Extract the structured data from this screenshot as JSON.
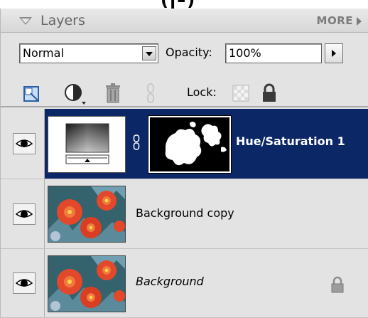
{
  "panel": {
    "title": "Layers",
    "more_label": "MORE",
    "top_glyphs": "(ן–)"
  },
  "controls": {
    "blend_mode": "Normal",
    "opacity_label": "Opacity:",
    "opacity_value": "100%",
    "lock_label": "Lock:"
  },
  "layers": [
    {
      "name": "Hue/Saturation 1",
      "selected": true,
      "type": "adjustment",
      "visible": true
    },
    {
      "name": "Background copy",
      "selected": false,
      "type": "image",
      "visible": true
    },
    {
      "name": "Background",
      "selected": false,
      "type": "image",
      "visible": true,
      "locked": true
    }
  ],
  "icons": {
    "new_layer": "new-layer-icon",
    "adjustment": "adjustment-layer-icon",
    "trash": "trash-icon",
    "link": "link-icon",
    "lock_transparency": "lock-transparency-icon",
    "lock_all": "lock-icon",
    "visibility": "eye-icon"
  },
  "colors": {
    "selected_row": "#0c2766",
    "panel_bg": "#e3e3e3"
  }
}
